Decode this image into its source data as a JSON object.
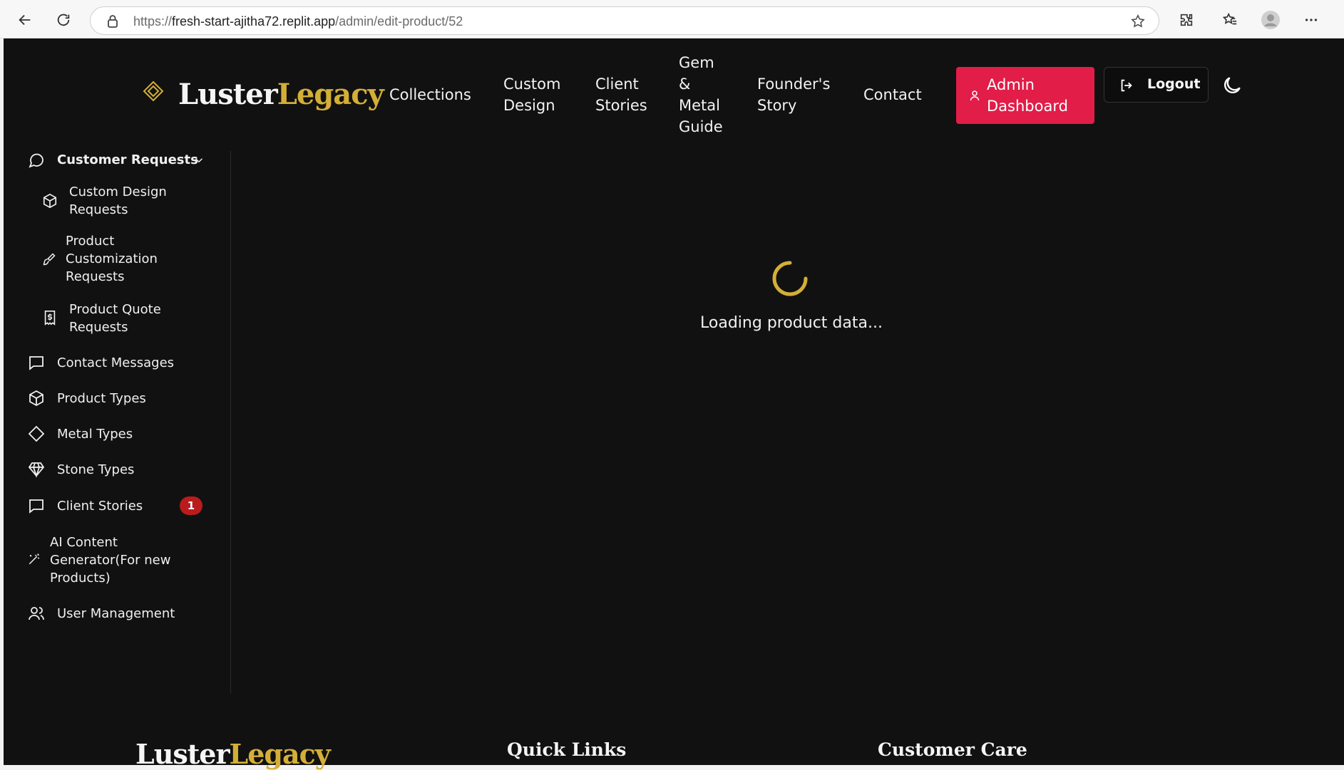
{
  "browser": {
    "url_scheme": "https://",
    "url_host": "fresh-start-ajitha72.replit.app",
    "url_path": "/admin/edit-product/52"
  },
  "header": {
    "logo_word1": "Luster",
    "logo_word2": "Legacy",
    "nav": {
      "collections": "Collections",
      "custom_design_1": "Custom",
      "custom_design_2": "Design",
      "client_stories_1": "Client",
      "client_stories_2": "Stories",
      "gem_1": "Gem",
      "gem_2": "&",
      "gem_3": "Metal",
      "gem_4": "Guide",
      "founder_1": "Founder's",
      "founder_2": "Story",
      "contact": "Contact"
    },
    "admin_button_1": "Admin",
    "admin_button_2": "Dashboard",
    "logout_button": "Logout",
    "accent_color": "#d4af37",
    "admin_color": "#e11d48"
  },
  "sidebar": {
    "customer_requests": "Customer Requests",
    "custom_design_requests_1": "Custom Design",
    "custom_design_requests_2": "Requests",
    "product_customization_1": "Product",
    "product_customization_2": "Customization",
    "product_customization_3": "Requests",
    "product_quote_1": "Product Quote",
    "product_quote_2": "Requests",
    "contact_messages": "Contact Messages",
    "product_types": "Product Types",
    "metal_types": "Metal Types",
    "stone_types": "Stone Types",
    "client_stories": "Client Stories",
    "client_stories_badge": "1",
    "ai_content_1": "AI Content",
    "ai_content_2": "Generator(For new",
    "ai_content_3": "Products)",
    "user_management": "User Management"
  },
  "main": {
    "loading_text": "Loading product data..."
  },
  "footer": {
    "logo_word1": "Luster",
    "logo_word2": "Legacy",
    "quick_links": "Quick Links",
    "customer_care": "Customer Care"
  }
}
